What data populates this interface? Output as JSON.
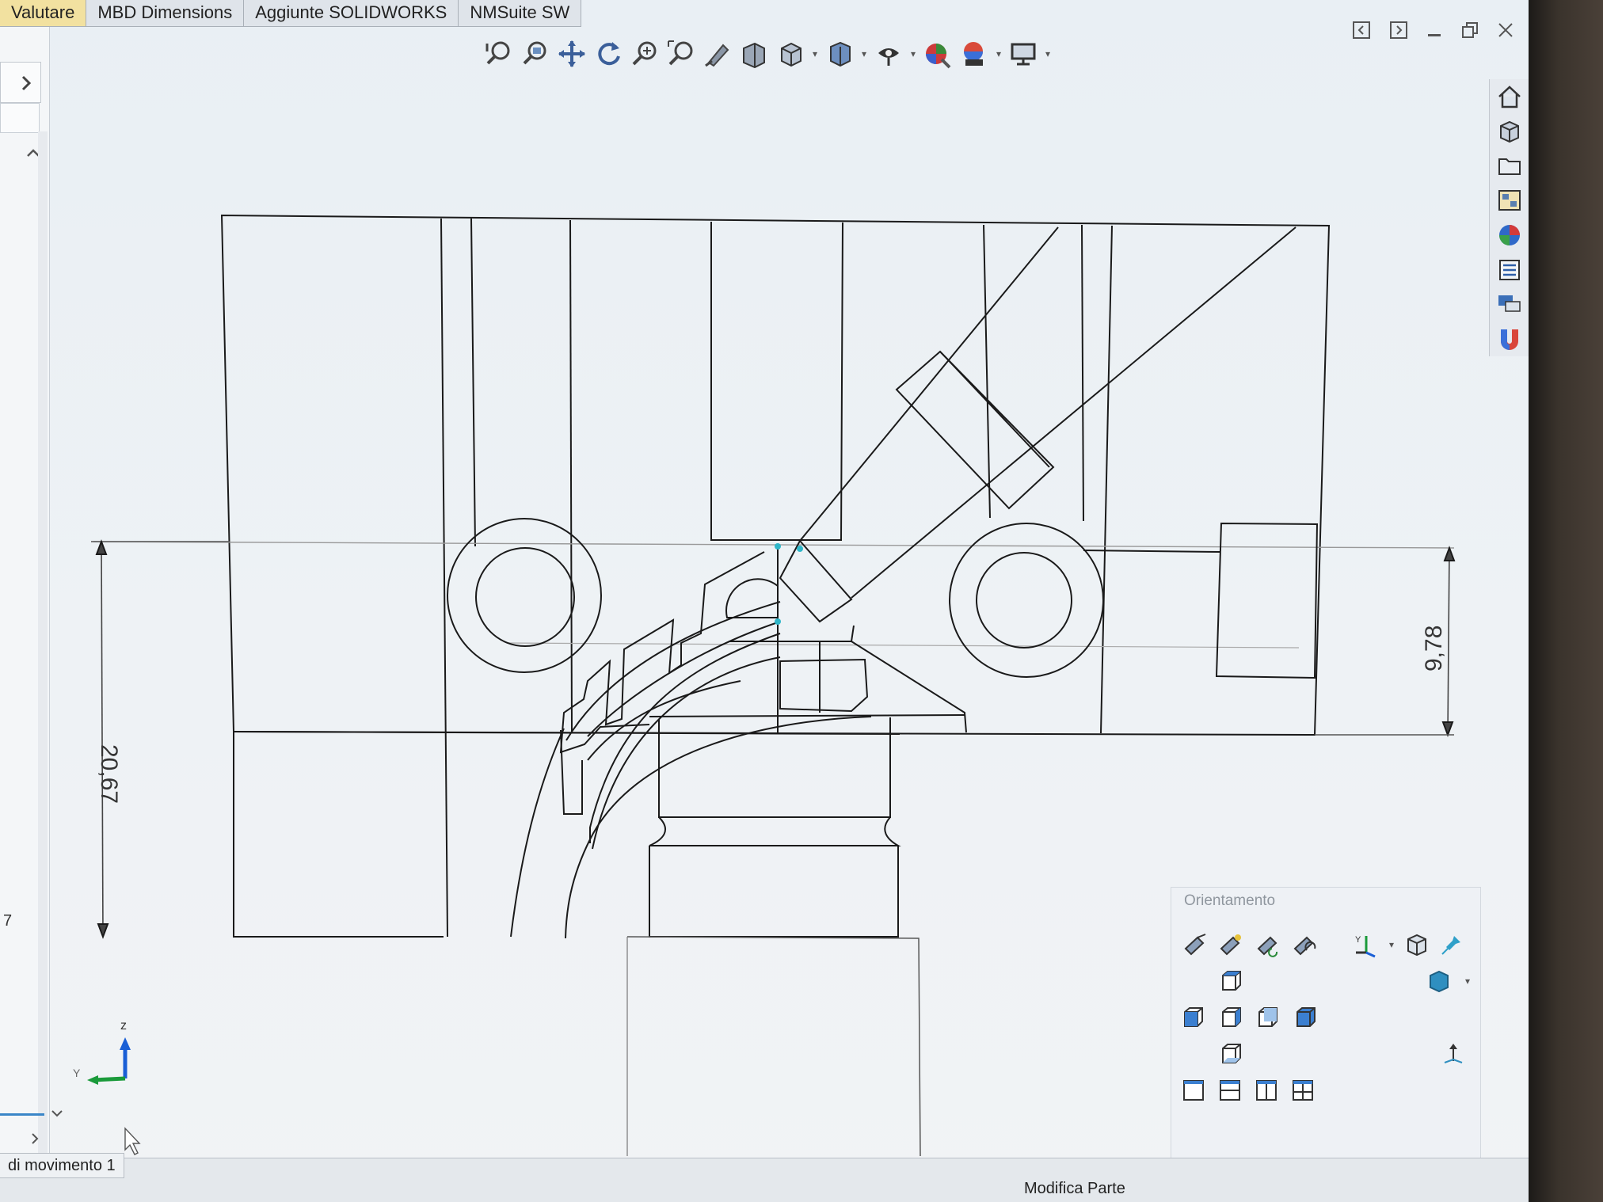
{
  "tabs": [
    "Valutare",
    "MBD Dimensions",
    "Aggiunte SOLIDWORKS",
    "NMSuite SW"
  ],
  "active_tab": "Valutare",
  "hud_toolbar": {
    "icons": [
      "zoom-to-fit-icon",
      "zoom-to-area-icon",
      "pan-icon",
      "rotate-icon",
      "zoom-in-out-icon",
      "zoom-selection-icon",
      "previous-view-icon",
      "section-view-icon",
      "view-orientation-icon",
      "display-style-icon",
      "hide-show-icon",
      "edit-appearance-icon",
      "apply-scene-icon",
      "view-settings-icon"
    ]
  },
  "window_controls": [
    "collapse-left-icon",
    "collapse-right-icon",
    "minimize-icon",
    "restore-icon",
    "close-icon"
  ],
  "task_pane": [
    "home-icon",
    "3d-part-icon",
    "folder-icon",
    "view-palette-icon",
    "appearances-icon",
    "custom-properties-icon",
    "forum-icon",
    "3dexperience-icon"
  ],
  "dimensions": {
    "left": "20,67",
    "right": "9,78"
  },
  "triad": {
    "z_label": "z",
    "y_label": "Y"
  },
  "left_panel": {
    "row_number": "7"
  },
  "orientation_panel": {
    "title": "Orientamento",
    "icons": [
      "normal-to-icon",
      "new-view-icon",
      "update-view-icon",
      "reset-view-icon",
      "triad-icon",
      "isometric-icon",
      "pin-icon",
      "top-view-icon",
      "front-view-icon",
      "left-view-icon",
      "back-view-icon",
      "right-view-icon",
      "bottom-view-icon",
      "single-view-icon",
      "two-view-horizontal-icon",
      "two-view-vertical-icon",
      "four-view-icon",
      "view-cube-icon",
      "perpendicular-icon"
    ]
  },
  "status": {
    "motion_tab": "di movimento 1",
    "mode": "Modifica Parte"
  },
  "colors": {
    "tab_active": "#f2e1a0",
    "sketch_line": "#1a1a1a",
    "triad_z": "#1a5fd6",
    "triad_y": "#1a9a3a"
  }
}
